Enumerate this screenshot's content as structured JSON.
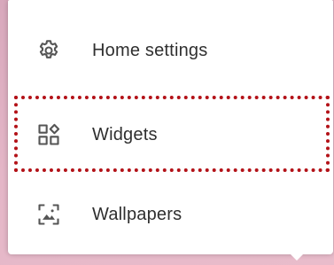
{
  "menu": {
    "items": [
      {
        "label": "Home settings",
        "icon": "gear-icon"
      },
      {
        "label": "Widgets",
        "icon": "widgets-icon"
      },
      {
        "label": "Wallpapers",
        "icon": "wallpaper-icon"
      }
    ],
    "highlighted_item": "Widgets"
  },
  "colors": {
    "background": "#e4b6c7",
    "menu_background": "#ffffff",
    "text": "#2f2f2f",
    "icon": "#555555",
    "highlight_border": "#b31218"
  }
}
